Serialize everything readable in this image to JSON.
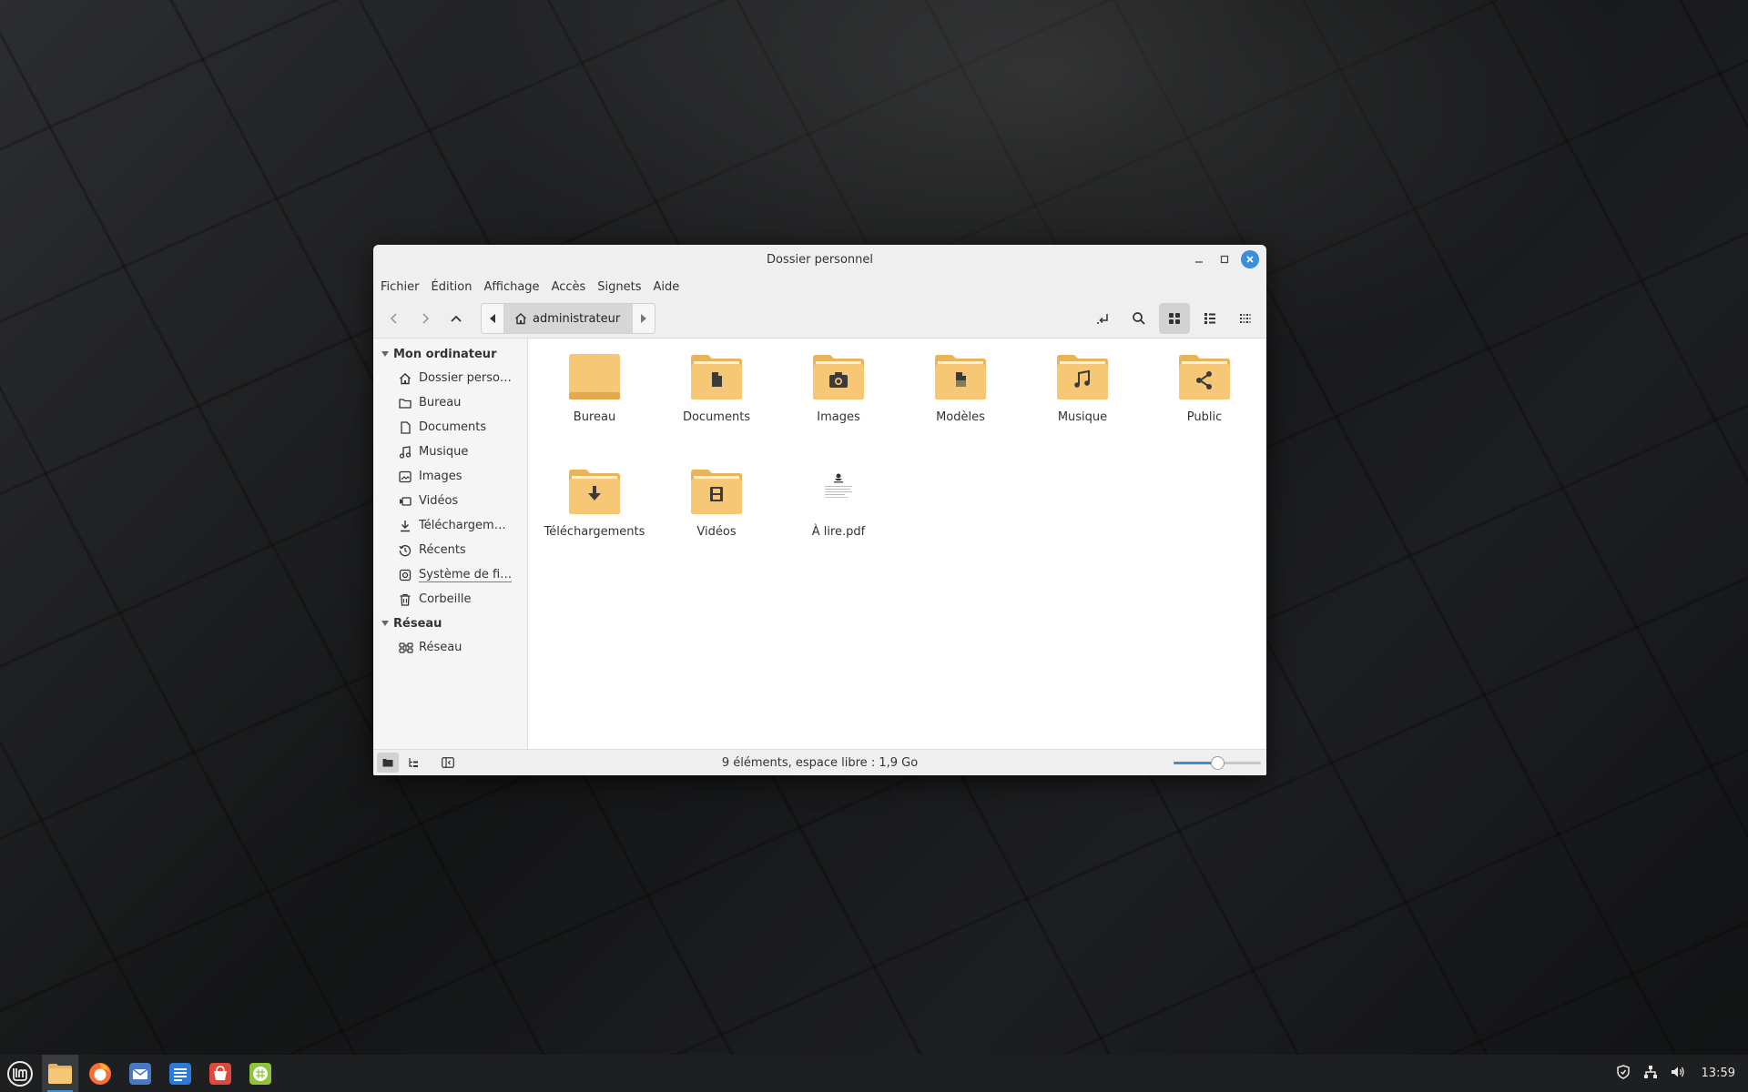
{
  "window": {
    "title": "Dossier personnel"
  },
  "menu": [
    "Fichier",
    "Édition",
    "Affichage",
    "Accès",
    "Signets",
    "Aide"
  ],
  "pathbar": {
    "current": "administrateur"
  },
  "sidebar": {
    "sections": [
      {
        "title": "Mon ordinateur",
        "items": [
          {
            "label": "Dossier perso…",
            "icon": "home-icon"
          },
          {
            "label": "Bureau",
            "icon": "folder-icon"
          },
          {
            "label": "Documents",
            "icon": "document-icon"
          },
          {
            "label": "Musique",
            "icon": "music-icon"
          },
          {
            "label": "Images",
            "icon": "image-icon"
          },
          {
            "label": "Vidéos",
            "icon": "video-icon"
          },
          {
            "label": "Téléchargem…",
            "icon": "download-icon"
          },
          {
            "label": "Récents",
            "icon": "history-icon"
          },
          {
            "label": "Système de fi…",
            "icon": "drive-icon"
          },
          {
            "label": "Corbeille",
            "icon": "trash-icon"
          }
        ]
      },
      {
        "title": "Réseau",
        "items": [
          {
            "label": "Réseau",
            "icon": "network-icon"
          }
        ]
      }
    ]
  },
  "files": [
    {
      "name": "Bureau",
      "icon": "folder-desktop-icon"
    },
    {
      "name": "Documents",
      "icon": "folder-documents-icon"
    },
    {
      "name": "Images",
      "icon": "folder-pictures-icon"
    },
    {
      "name": "Modèles",
      "icon": "folder-templates-icon"
    },
    {
      "name": "Musique",
      "icon": "folder-music-icon"
    },
    {
      "name": "Public",
      "icon": "folder-public-icon"
    },
    {
      "name": "Téléchargements",
      "icon": "folder-download-icon"
    },
    {
      "name": "Vidéos",
      "icon": "folder-videos-icon"
    },
    {
      "name": "À lire.pdf",
      "icon": "pdf-thumbnail-icon"
    }
  ],
  "statusbar": {
    "text": "9 éléments, espace libre : 1,9 Go",
    "zoom_level": 0.5
  },
  "taskbar": {
    "apps": [
      "mint-menu-icon",
      "files-icon",
      "firefox-icon",
      "mail-icon",
      "writer-icon",
      "store-icon",
      "calc-icon"
    ],
    "clock": "13:59"
  },
  "colors": {
    "accent": "#3a8fd9",
    "folder": "#f6c774",
    "folder_dark": "#e8b45a"
  }
}
